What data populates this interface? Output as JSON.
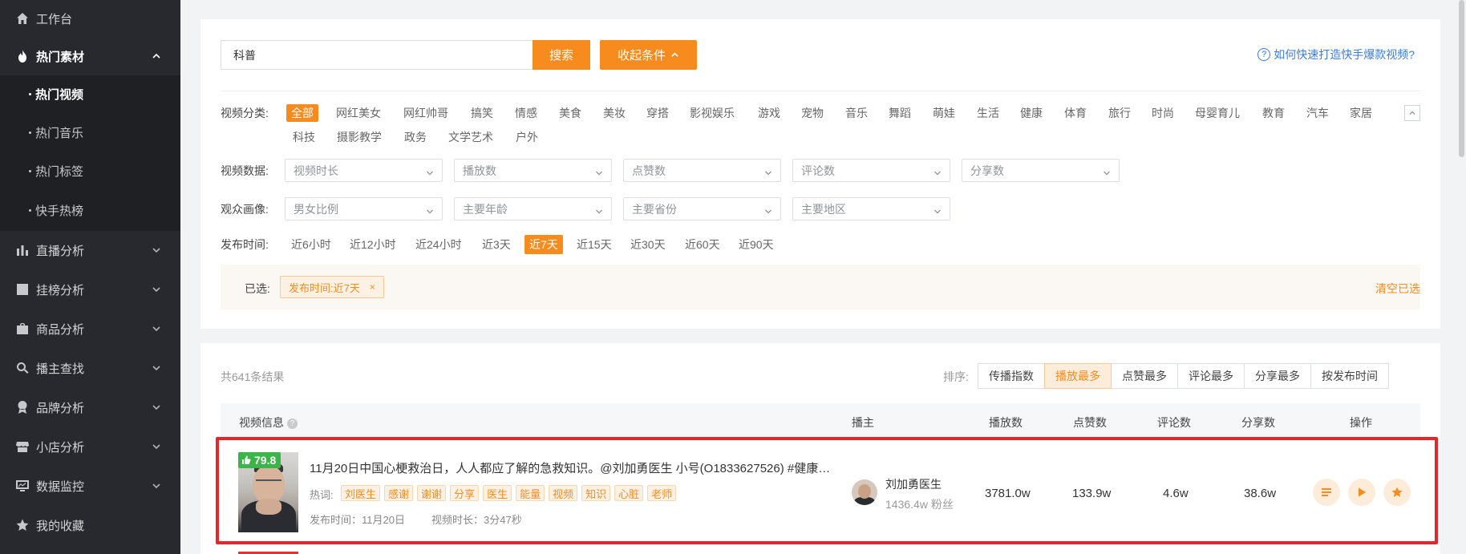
{
  "sidebar": {
    "items": [
      {
        "label": "工作台",
        "icon": "home-icon"
      },
      {
        "label": "热门素材",
        "icon": "fire-icon"
      },
      {
        "label": "直播分析",
        "icon": "bar-chart-icon"
      },
      {
        "label": "挂榜分析",
        "icon": "line-chart-icon"
      },
      {
        "label": "商品分析",
        "icon": "bag-icon"
      },
      {
        "label": "播主查找",
        "icon": "search-icon"
      },
      {
        "label": "品牌分析",
        "icon": "award-icon"
      },
      {
        "label": "小店分析",
        "icon": "store-icon"
      },
      {
        "label": "数据监控",
        "icon": "monitor-icon"
      },
      {
        "label": "我的收藏",
        "icon": "star-icon"
      }
    ],
    "sub_items": [
      {
        "label": "热门视频"
      },
      {
        "label": "热门音乐"
      },
      {
        "label": "热门标签"
      },
      {
        "label": "快手热榜"
      }
    ]
  },
  "search": {
    "value": "科普",
    "search_button": "搜索",
    "collapse_button": "收起条件",
    "help_link": "如何快速打造快手爆款视频?"
  },
  "filters": {
    "category_label": "视频分类:",
    "categories": [
      "全部",
      "网红美女",
      "网红帅哥",
      "搞笑",
      "情感",
      "美食",
      "美妆",
      "穿搭",
      "影视娱乐",
      "游戏",
      "宠物",
      "音乐",
      "舞蹈",
      "萌娃",
      "生活",
      "健康",
      "体育",
      "旅行",
      "时尚",
      "母婴育儿",
      "教育",
      "汽车",
      "家居",
      "科技",
      "摄影教学",
      "政务",
      "文学艺术",
      "户外"
    ],
    "selected_category": "全部",
    "data_label": "视频数据:",
    "data_selects": [
      "视频时长",
      "播放数",
      "点赞数",
      "评论数",
      "分享数"
    ],
    "audience_label": "观众画像:",
    "audience_selects": [
      "男女比例",
      "主要年龄",
      "主要省份",
      "主要地区"
    ],
    "time_label": "发布时间:",
    "times": [
      "近6小时",
      "近12小时",
      "近24小时",
      "近3天",
      "近7天",
      "近15天",
      "近30天",
      "近60天",
      "近90天"
    ],
    "selected_time": "近7天",
    "chosen_label": "已选:",
    "chosen_tag": "发布时间:近7天",
    "chosen_tag_close": "×",
    "clear_link": "清空已选"
  },
  "results": {
    "total": "共641条结果",
    "sort_label": "排序:",
    "sort_options": [
      "传播指数",
      "播放最多",
      "点赞最多",
      "评论最多",
      "分享最多",
      "按发布时间"
    ],
    "sort_active": "播放最多",
    "columns": {
      "video_info": "视频信息",
      "video_info_help": "?",
      "anchor": "播主",
      "plays": "播放数",
      "likes": "点赞数",
      "comments": "评论数",
      "shares": "分享数",
      "actions": "操作"
    },
    "rows": [
      {
        "score": "79.8",
        "title": "11月20日中国心梗救治日，人人都应了解的急救知识。@刘加勇医生 小号(O1833627526) #健康科...",
        "hot_label": "热词:",
        "hot_words": [
          "刘医生",
          "感谢",
          "谢谢",
          "分享",
          "医生",
          "能量",
          "视频",
          "知识",
          "心脏",
          "老师"
        ],
        "publish_time": "发布时间：11月20日",
        "duration": "视频时长：3分47秒",
        "anchor_name": "刘加勇医生",
        "anchor_fans": "1436.4w 粉丝",
        "plays": "3781.0w",
        "likes": "133.9w",
        "comments": "4.6w",
        "shares": "38.6w",
        "actions": [
          "list-icon",
          "play-icon",
          "star-icon"
        ]
      }
    ]
  },
  "colors": {
    "accent": "#f88b1e",
    "sidebar_bg": "#28292e",
    "highlight": "#e8262a",
    "score_bg": "#3bb54a",
    "link": "#3a7dd8"
  }
}
